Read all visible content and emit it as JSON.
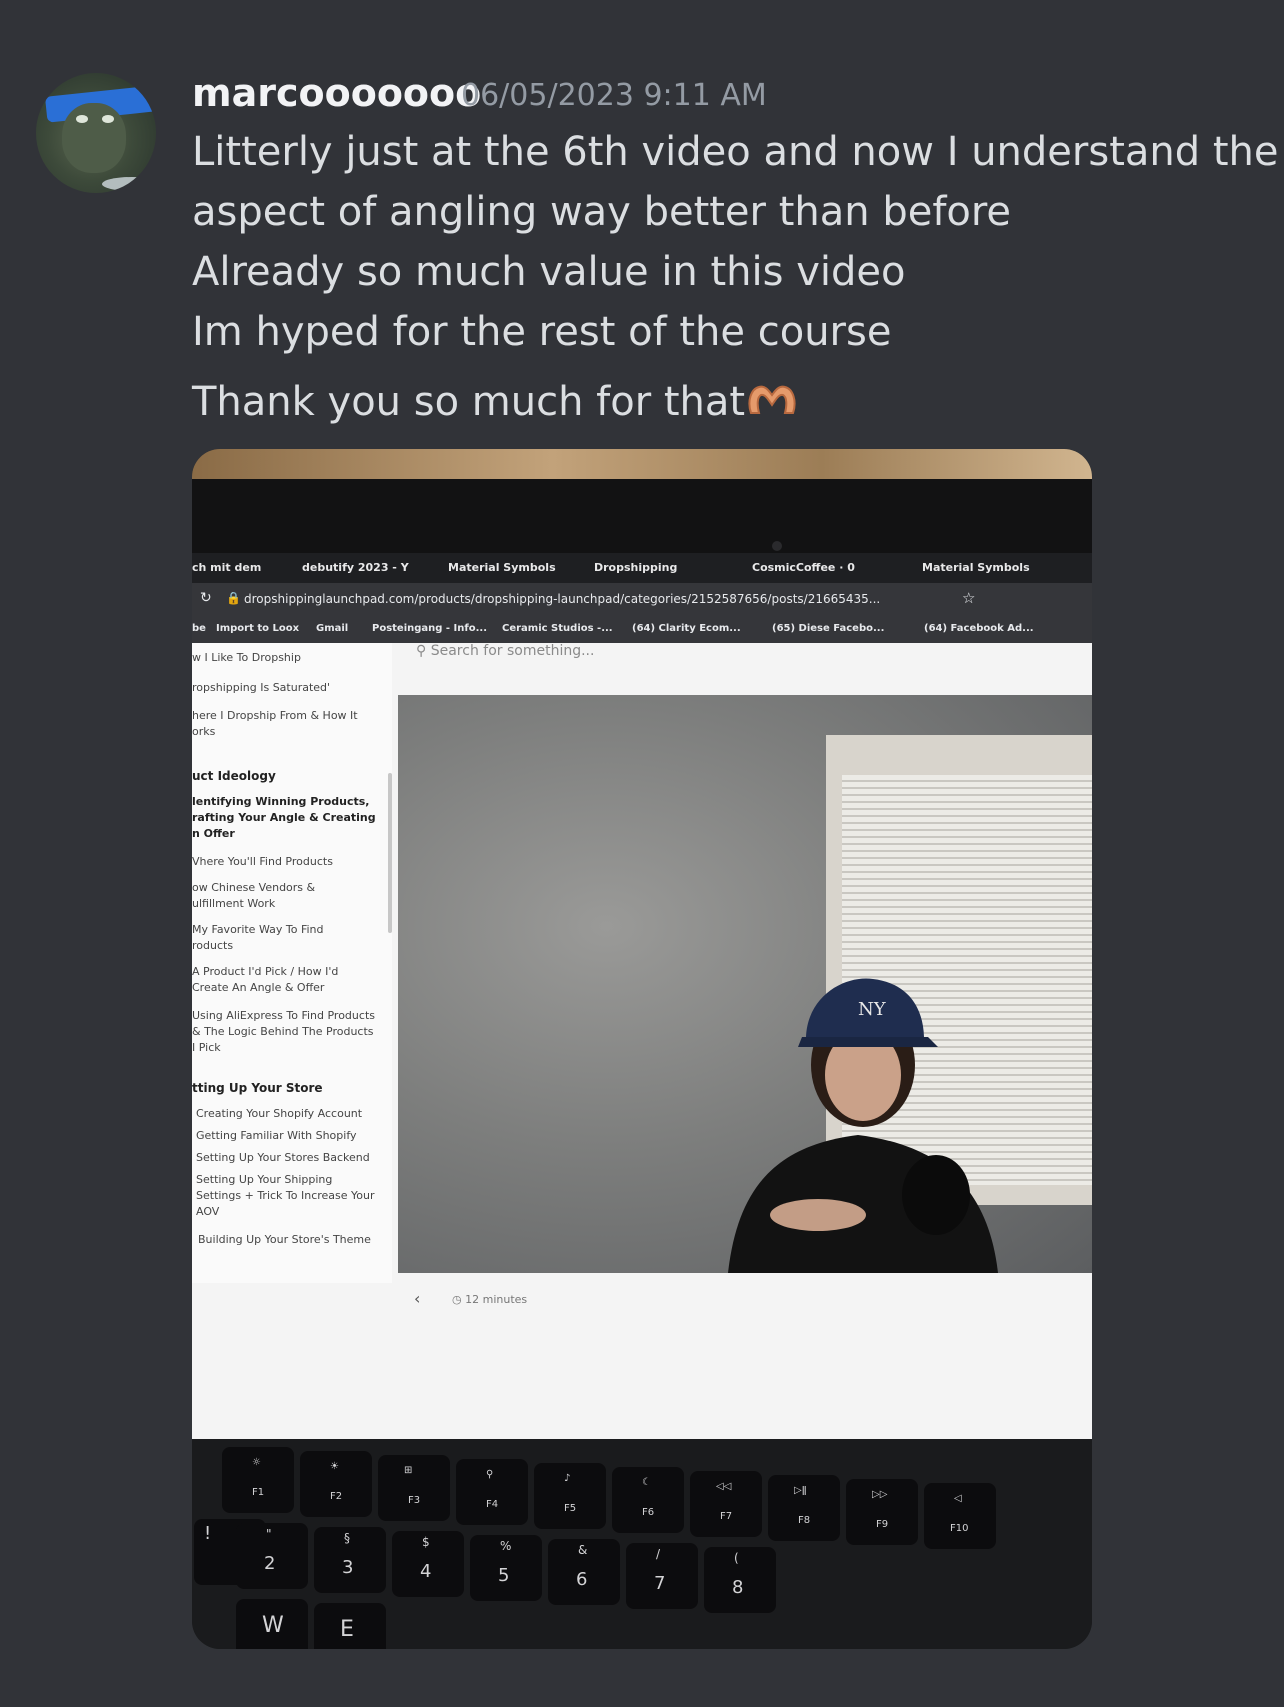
{
  "message": {
    "username": "marcooooooo",
    "timestamp": "06/05/2023 9:11 AM",
    "lines": [
      "Litterly just at the 6th video and now I understand the",
      "aspect of angling way better than before",
      "Already so much value in this video",
      "Im hyped for the rest of the course",
      "Thank you so much for that"
    ],
    "emoji": "heart-hands"
  },
  "photo": {
    "tabs": [
      "ch mit dem",
      "debutify 2023 - Y",
      "Material Symbols",
      "Dropshipping",
      "CosmicCoffee · 0",
      "Material Symbols"
    ],
    "url": "dropshippinglaunchpad.com/products/dropshipping-launchpad/categories/2152587656/posts/21665435...",
    "bookmarks": [
      "be",
      "Import to Loox",
      "Gmail",
      "Posteingang - Info...",
      "Ceramic Studios -...",
      "(64) Clarity Ecom...",
      "(65) Diese Facebo...",
      "(64) Facebook Ad..."
    ],
    "search_placeholder": "Search for something...",
    "sidebar": [
      "w I Like To Dropship",
      "ropshipping Is Saturated'",
      "here I Dropship From & How It",
      "orks",
      "uct Ideology",
      "lentifying Winning Products,",
      "rafting Your Angle & Creating",
      "n Offer",
      "Vhere You'll Find Products",
      "ow Chinese Vendors &",
      "ulfillment Work",
      "My Favorite Way To Find",
      "roducts",
      "A Product I'd Pick / How I'd",
      "Create An Angle & Offer",
      "Using AliExpress To Find Products",
      "& The Logic Behind The Products",
      "I Pick",
      "tting Up Your Store",
      "Creating Your Shopify Account",
      "Getting Familiar With Shopify",
      "Setting Up Your Stores Backend",
      "Setting Up Your Shipping",
      "Settings + Trick To Increase Your",
      "AOV",
      "Building Up Your Store's Theme"
    ],
    "duration": "12 minutes",
    "fkeys": [
      "F1",
      "F2",
      "F3",
      "F4",
      "F5",
      "F6",
      "F7",
      "F8",
      "F9",
      "F10"
    ],
    "number_keys": [
      "!",
      "2",
      "3",
      "4",
      "5",
      "6",
      "7",
      "8"
    ],
    "number_symbols": [
      "",
      "\"",
      "§",
      "$",
      "%",
      "&",
      "/",
      "("
    ],
    "letter_keys": [
      "W",
      "E"
    ]
  }
}
